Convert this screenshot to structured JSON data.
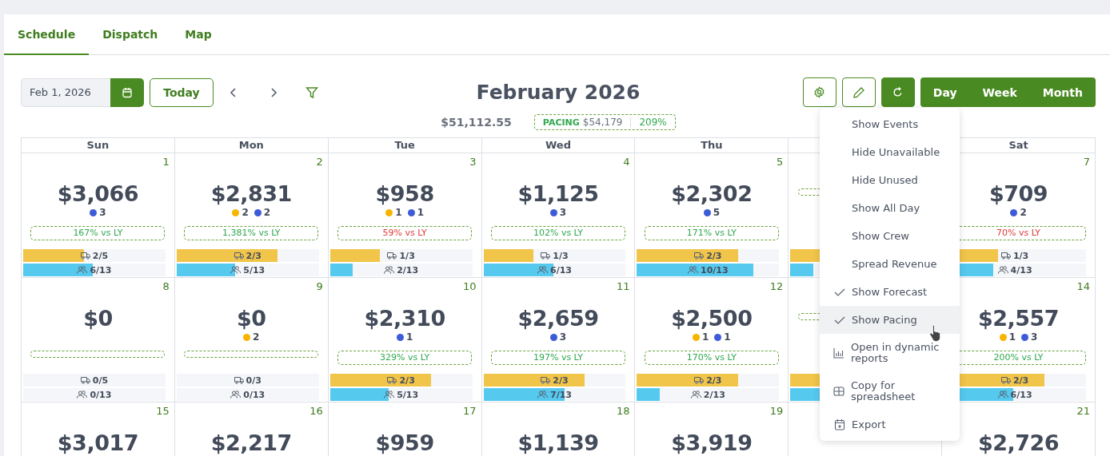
{
  "tabs": [
    {
      "label": "Schedule",
      "selected": true
    },
    {
      "label": "Dispatch",
      "selected": false
    },
    {
      "label": "Map",
      "selected": false
    }
  ],
  "toolbar": {
    "date_field": {
      "value": "Feb 1, 2026"
    },
    "today_button": "Today",
    "title": "February 2026",
    "views": [
      "Day",
      "Week",
      "Month"
    ]
  },
  "summary": {
    "total": "$51,112.55",
    "pacing_label": "PACING",
    "pacing_amount": "$54,179",
    "pacing_percent": "209%"
  },
  "columns": [
    {
      "weekday": "Sun",
      "cells": [
        {
          "day": "1",
          "amount": "$3,066",
          "events": [
            {
              "color": "#3d5bd9",
              "count": "3"
            }
          ],
          "vs_ly": "167% vs LY",
          "below_last_year": false,
          "trucks": {
            "reading": "2/5",
            "level": 0.43
          },
          "crew": {
            "reading": "6/13",
            "level": 0.49
          }
        },
        {
          "day": "8",
          "amount": "$0",
          "trucks": {
            "reading": "0/5",
            "level": 0
          },
          "crew": {
            "reading": "0/13",
            "level": 0
          }
        },
        {
          "day": "15",
          "amount": "$3,017"
        }
      ]
    },
    {
      "weekday": "Mon",
      "cells": [
        {
          "day": "2",
          "amount": "$2,831",
          "events": [
            {
              "color": "#f7b500",
              "count": "2"
            },
            {
              "color": "#3d5bd9",
              "count": "2"
            }
          ],
          "vs_ly": "1,381% vs LY",
          "below_last_year": false,
          "trucks": {
            "reading": "2/3",
            "level": 0.71
          },
          "crew": {
            "reading": "5/13",
            "level": 0.41
          }
        },
        {
          "day": "9",
          "amount": "$0",
          "events": [
            {
              "color": "#f7b500",
              "count": "2"
            }
          ],
          "trucks": {
            "reading": "0/3",
            "level": 0
          },
          "crew": {
            "reading": "0/13",
            "level": 0
          }
        },
        {
          "day": "16",
          "amount": "$2,217"
        }
      ]
    },
    {
      "weekday": "Tue",
      "cells": [
        {
          "day": "3",
          "amount": "$958",
          "events": [
            {
              "color": "#f7b500",
              "count": "1"
            },
            {
              "color": "#3d5bd9",
              "count": "1"
            }
          ],
          "vs_ly": "59% vs LY",
          "below_last_year": true,
          "trucks": {
            "reading": "1/3",
            "level": 0.35
          },
          "crew": {
            "reading": "2/13",
            "level": 0.16
          }
        },
        {
          "day": "10",
          "amount": "$2,310",
          "events": [
            {
              "color": "#3d5bd9",
              "count": "1"
            }
          ],
          "vs_ly": "329% vs LY",
          "below_last_year": false,
          "trucks": {
            "reading": "2/3",
            "level": 0.71
          },
          "crew": {
            "reading": "5/13",
            "level": 0.41
          }
        },
        {
          "day": "17",
          "amount": "$959"
        }
      ]
    },
    {
      "weekday": "Wed",
      "cells": [
        {
          "day": "4",
          "amount": "$1,125",
          "events": [
            {
              "color": "#3d5bd9",
              "count": "3"
            }
          ],
          "vs_ly": "102% vs LY",
          "below_last_year": false,
          "trucks": {
            "reading": "1/3",
            "level": 0.35
          },
          "crew": {
            "reading": "6/13",
            "level": 0.49
          }
        },
        {
          "day": "11",
          "amount": "$2,659",
          "events": [
            {
              "color": "#3d5bd9",
              "count": "3"
            }
          ],
          "vs_ly": "197% vs LY",
          "below_last_year": false,
          "trucks": {
            "reading": "2/3",
            "level": 0.71
          },
          "crew": {
            "reading": "7/13",
            "level": 0.57
          }
        },
        {
          "day": "18",
          "amount": "$1,139"
        }
      ]
    },
    {
      "weekday": "Thu",
      "cells": [
        {
          "day": "5",
          "amount": "$2,302",
          "events": [
            {
              "color": "#3d5bd9",
              "count": "5"
            }
          ],
          "vs_ly": "171% vs LY",
          "below_last_year": false,
          "trucks": {
            "reading": "2/3",
            "level": 0.71
          },
          "crew": {
            "reading": "10/13",
            "level": 0.82
          }
        },
        {
          "day": "12",
          "amount": "$2,500",
          "events": [
            {
              "color": "#f7b500",
              "count": "1"
            },
            {
              "color": "#3d5bd9",
              "count": "1"
            }
          ],
          "vs_ly": "170% vs LY",
          "below_last_year": false,
          "trucks": {
            "reading": "2/3",
            "level": 0.71
          },
          "crew": {
            "reading": "2/13",
            "level": 0.16
          }
        },
        {
          "day": "19",
          "amount": "$3,919"
        }
      ]
    },
    {
      "cells": [
        {
          "trucks": {
            "level": 0.71
          },
          "crew": {
            "level": 0.16
          }
        },
        {
          "trucks": {
            "level": 0.71
          },
          "crew": {
            "level": 0.5
          }
        }
      ]
    },
    {
      "weekday": "Sat",
      "cells": [
        {
          "day": "7",
          "amount": "$709",
          "events": [
            {
              "color": "#3d5bd9",
              "count": "2"
            }
          ],
          "vs_ly": "70% vs LY",
          "below_last_year": true,
          "trucks": {
            "reading": "1/3",
            "level": 0.38
          },
          "crew": {
            "reading": "4/13",
            "level": 0.35
          }
        },
        {
          "day": "14",
          "amount": "$2,557",
          "events": [
            {
              "color": "#f7b500",
              "count": "1"
            },
            {
              "color": "#3d5bd9",
              "count": "3"
            }
          ],
          "vs_ly": "200% vs LY",
          "below_last_year": false,
          "trucks": {
            "reading": "2/3",
            "level": 0.71
          },
          "crew": {
            "reading": "6/13",
            "level": 0.49
          }
        },
        {
          "day": "21",
          "amount": "$2,726"
        }
      ]
    }
  ],
  "settings_menu": [
    {
      "kind": "toggle",
      "label": "Show Events",
      "checked": false,
      "hovered": false
    },
    {
      "kind": "toggle",
      "label": "Hide Unavailable",
      "checked": false,
      "hovered": false
    },
    {
      "kind": "toggle",
      "label": "Hide Unused",
      "checked": false,
      "hovered": false
    },
    {
      "kind": "toggle",
      "label": "Show All Day",
      "checked": false,
      "hovered": false
    },
    {
      "kind": "toggle",
      "label": "Show Crew",
      "checked": false,
      "hovered": false
    },
    {
      "kind": "toggle",
      "label": "Spread Revenue",
      "checked": false,
      "hovered": false
    },
    {
      "kind": "toggle",
      "label": "Show Forecast",
      "checked": true,
      "hovered": false
    },
    {
      "kind": "toggle",
      "label": "Show Pacing",
      "checked": true,
      "hovered": true
    },
    {
      "kind": "report",
      "label": "Open in dynamic reports",
      "hovered": false
    },
    {
      "kind": "copy",
      "label": "Copy for spreadsheet",
      "hovered": false
    },
    {
      "kind": "export",
      "label": "Export",
      "hovered": false
    }
  ]
}
